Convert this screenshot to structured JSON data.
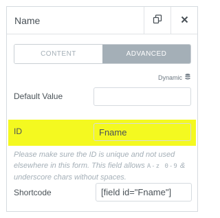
{
  "header": {
    "title": "Name",
    "duplicate_icon": "duplicate-icon",
    "close_icon": "close-icon"
  },
  "tabs": [
    {
      "label": "CONTENT",
      "active": false
    },
    {
      "label": "ADVANCED",
      "active": true
    }
  ],
  "dynamic": {
    "label": "Dynamic",
    "icon": "database-icon"
  },
  "fields": {
    "default_value": {
      "label": "Default Value",
      "value": ""
    },
    "id": {
      "label": "ID",
      "value": "Fname"
    },
    "shortcode": {
      "label": "Shortcode",
      "value": "[field id=\"Fname\"]"
    }
  },
  "help": {
    "text_1": "Please make sure the ID is unique and not used elsewhere in this form. This field allows",
    "code": "A-z 0-9",
    "text_2": "& underscore chars without spaces."
  },
  "colors": {
    "highlight": "#f4f920",
    "tab_active_bg": "#a4afb7",
    "border": "#d5dadf"
  }
}
